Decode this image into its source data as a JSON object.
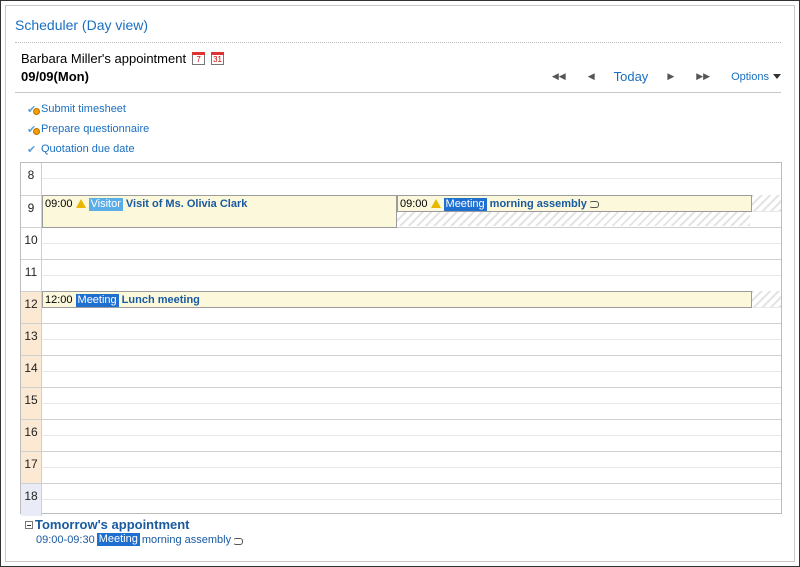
{
  "page_title": "Scheduler (Day view)",
  "owner_label": "Barbara Miller's appointment",
  "icons": {
    "week_calendar": "7",
    "month_calendar": "31"
  },
  "date_label": "09/09(Mon)",
  "nav": {
    "today_label": "Today",
    "options_label": "Options"
  },
  "todos": [
    {
      "label": "Submit timesheet",
      "icon": "check-warning-icon"
    },
    {
      "label": "Prepare questionnaire",
      "icon": "check-warning-icon"
    },
    {
      "label": "Quotation due date",
      "icon": "check-icon"
    }
  ],
  "hours": [
    "8",
    "9",
    "10",
    "11",
    "12",
    "13",
    "14",
    "15",
    "16",
    "17",
    "18"
  ],
  "events": [
    {
      "time": "09:00",
      "tag": "Visitor",
      "title": "Visit of Ms. Olivia Clark",
      "warning": true,
      "repeat": false
    },
    {
      "time": "09:00",
      "tag": "Meeting",
      "title": "morning assembly",
      "warning": true,
      "repeat": true
    },
    {
      "time": "12:00",
      "tag": "Meeting",
      "title": "Lunch meeting",
      "warning": false,
      "repeat": false
    }
  ],
  "tomorrow": {
    "heading": "Tomorrow's appointment",
    "item": {
      "time": "09:00-09:30",
      "tag": "Meeting",
      "title": "morning assembly"
    }
  },
  "colors": {
    "link": "#1a6fc0",
    "visitor_tag": "#5aaee8",
    "meeting_tag": "#1f6fd1",
    "event_bg": "#fbf8dc",
    "work_hour_bg": "#fbe9d3"
  }
}
